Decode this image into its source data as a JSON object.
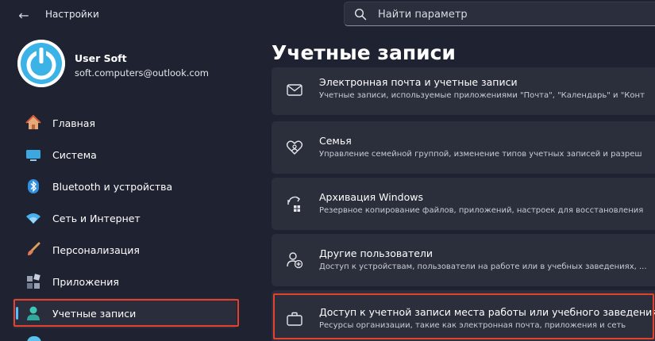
{
  "window": {
    "back_label": "←",
    "app_title": "Настройки"
  },
  "search": {
    "placeholder": "Найти параметр"
  },
  "profile": {
    "name": "User Soft",
    "email": "soft.computers@outlook.com"
  },
  "sidebar": {
    "items": [
      {
        "label": "Главная",
        "icon": "home-icon"
      },
      {
        "label": "Система",
        "icon": "system-icon"
      },
      {
        "label": "Bluetooth и устройства",
        "icon": "bluetooth-icon"
      },
      {
        "label": "Сеть и Интернет",
        "icon": "wifi-icon"
      },
      {
        "label": "Персонализация",
        "icon": "brush-icon"
      },
      {
        "label": "Приложения",
        "icon": "apps-icon"
      },
      {
        "label": "Учетные записи",
        "icon": "account-icon",
        "active": true
      }
    ]
  },
  "main": {
    "title": "Учетные записи",
    "cards": [
      {
        "title": "Электронная почта и учетные записи",
        "subtitle": "Учетные записи, используемые приложениями \"Почта\", \"Календарь\" и \"Конт",
        "icon": "mail-icon"
      },
      {
        "title": "Семья",
        "subtitle": "Управление семейной группой, изменение типов учетных записей и разреш",
        "icon": "family-heart-icon"
      },
      {
        "title": "Архивация Windows",
        "subtitle": "Резервное копирование файлов, приложений, настроек для восстановления",
        "icon": "backup-icon"
      },
      {
        "title": "Другие пользователи",
        "subtitle": "Доступ к устройствам, пользователи на работе или в учебных заведениях, ...",
        "icon": "add-user-icon"
      },
      {
        "title": "Доступ к учетной записи места работы или учебного заведения",
        "subtitle": "Ресурсы организации, такие как электронная почта, приложения и сеть",
        "icon": "briefcase-icon"
      }
    ]
  },
  "colors": {
    "background": "#1f2230",
    "card": "#2b2e3b",
    "accent": "#4cc2ff",
    "highlight": "#e8402f"
  }
}
